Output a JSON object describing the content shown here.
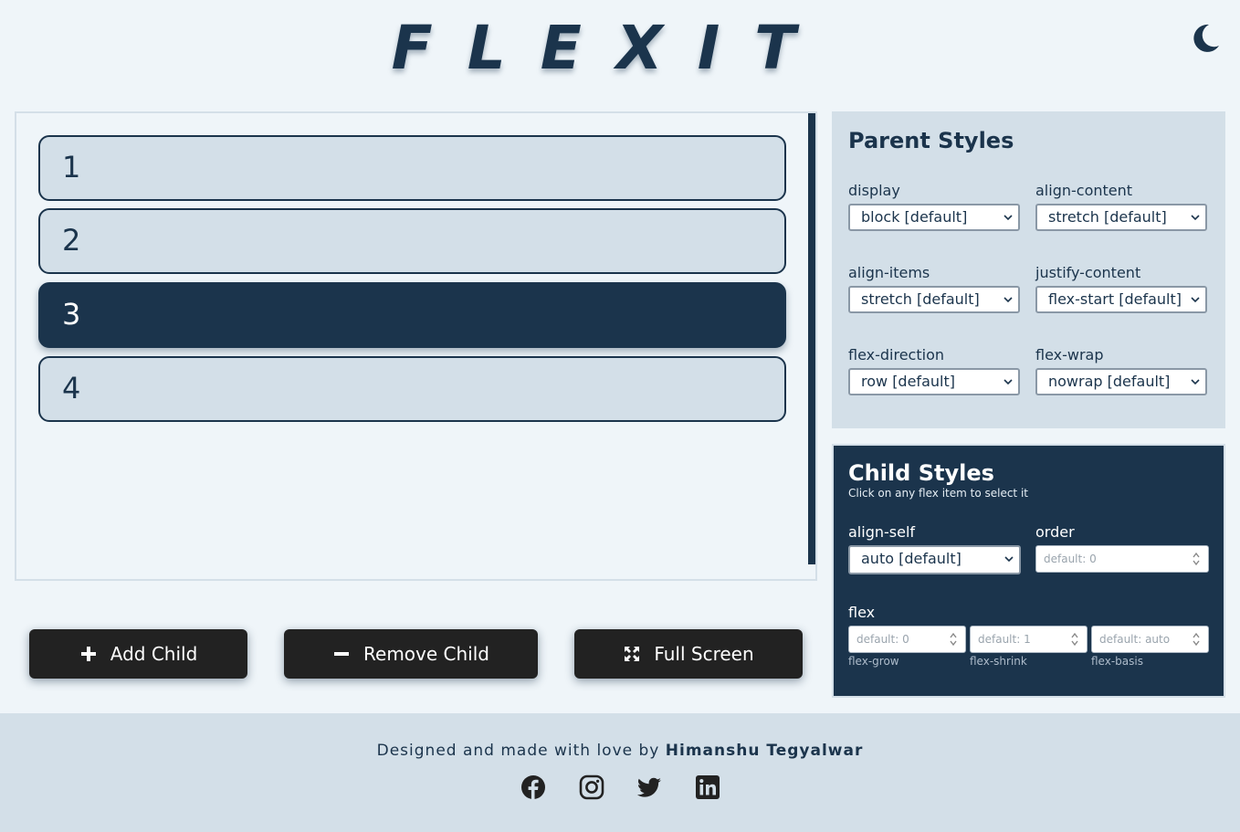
{
  "header": {
    "logo": "FLEXIT",
    "theme_icon": "moon-icon"
  },
  "playground": {
    "items": [
      {
        "label": "1",
        "selected": false
      },
      {
        "label": "2",
        "selected": false
      },
      {
        "label": "3",
        "selected": true
      },
      {
        "label": "4",
        "selected": false
      }
    ]
  },
  "actions": {
    "add": {
      "label": "Add Child",
      "icon": "plus-icon"
    },
    "remove": {
      "label": "Remove Child",
      "icon": "minus-icon"
    },
    "fullscreen": {
      "label": "Full Screen",
      "icon": "expand-icon"
    }
  },
  "parent_styles": {
    "title": "Parent Styles",
    "fields": {
      "display": {
        "label": "display",
        "value": "block [default]"
      },
      "align_content": {
        "label": "align-content",
        "value": "stretch [default]"
      },
      "align_items": {
        "label": "align-items",
        "value": "stretch [default]"
      },
      "justify_content": {
        "label": "justify-content",
        "value": "flex-start [default]"
      },
      "flex_direction": {
        "label": "flex-direction",
        "value": "row [default]"
      },
      "flex_wrap": {
        "label": "flex-wrap",
        "value": "nowrap [default]"
      }
    }
  },
  "child_styles": {
    "title": "Child Styles",
    "hint": "Click on any flex item to select it",
    "align_self": {
      "label": "align-self",
      "value": "auto [default]"
    },
    "order": {
      "label": "order",
      "placeholder": "default: 0"
    },
    "flex": {
      "label": "flex",
      "grow": {
        "placeholder": "default: 0",
        "sub": "flex-grow"
      },
      "shrink": {
        "placeholder": "default: 1",
        "sub": "flex-shrink"
      },
      "basis": {
        "placeholder": "default: auto",
        "sub": "flex-basis"
      }
    }
  },
  "footer": {
    "credit_prefix": "Designed and made with love by",
    "author": "Himanshu Tegyalwar",
    "socials": [
      "facebook-icon",
      "instagram-icon",
      "twitter-icon",
      "linkedin-icon"
    ]
  },
  "colors": {
    "primary": "#1b344c",
    "panel": "#d3dfe8",
    "background": "#eff5f9",
    "button": "#222222"
  }
}
